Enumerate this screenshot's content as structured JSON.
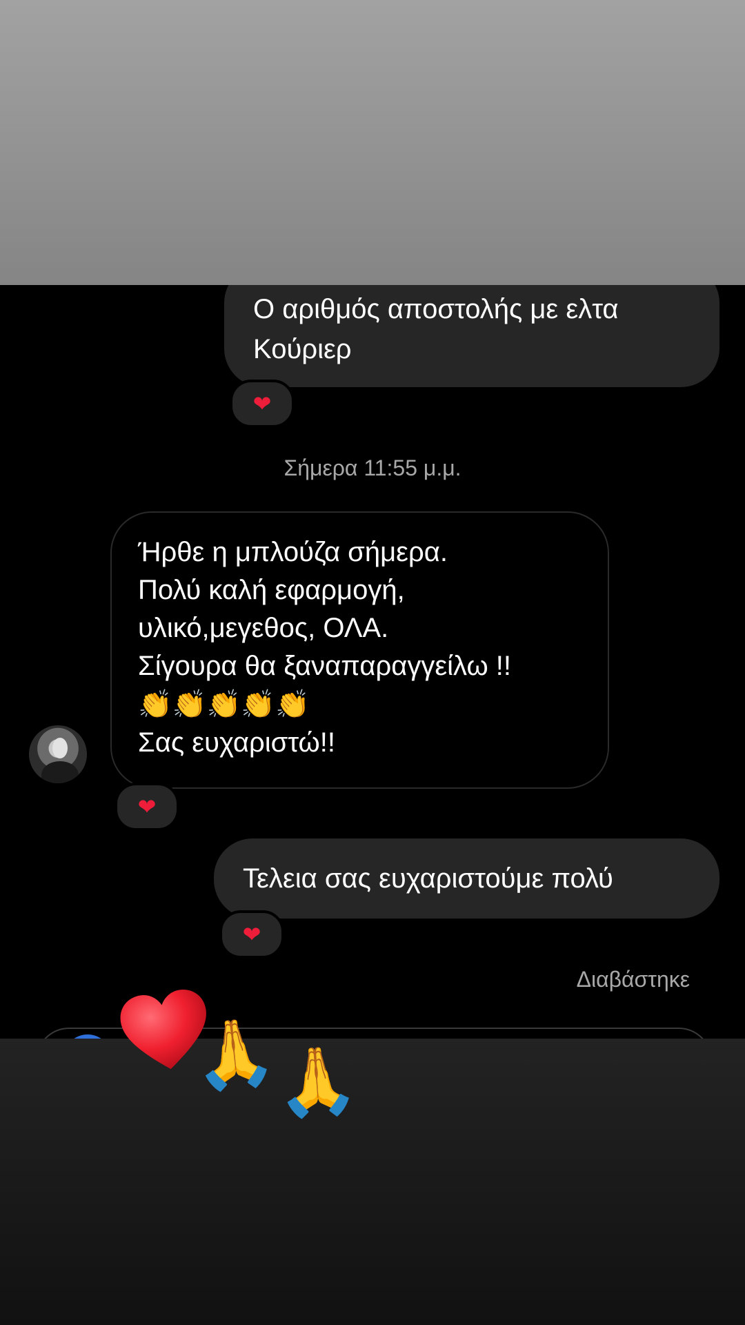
{
  "messages": {
    "out_1": {
      "line1": "Ο αριθμός αποστολής με ελτα",
      "line2": "Κούριερ"
    },
    "timestamp": "Σήμερα 11:55 μ.μ.",
    "in_1": {
      "lines": [
        "Ήρθε η μπλούζα σήμερα.",
        "Πολύ καλή εφαρμογή,",
        "υλικό,μεγεθος, ΟΛΑ.",
        "Σίγουρα θα ξαναπαραγγείλω !!"
      ],
      "claps": "👏👏👏👏👏",
      "last": "Σας ευχαριστώ!!"
    },
    "out_2": {
      "text": "Τελεια σας ευχαριστούμε πολύ"
    },
    "seen_label": "Διαβάστηκε"
  },
  "reactions": {
    "r1": "❤",
    "r2": "❤",
    "r3": "❤"
  },
  "overlay": {
    "pray_1": "🙏",
    "pray_2": "🙏"
  },
  "colors": {
    "bubble": "#262626",
    "heart": "#ee1d3a",
    "meta_text": "#a8a8a8"
  }
}
